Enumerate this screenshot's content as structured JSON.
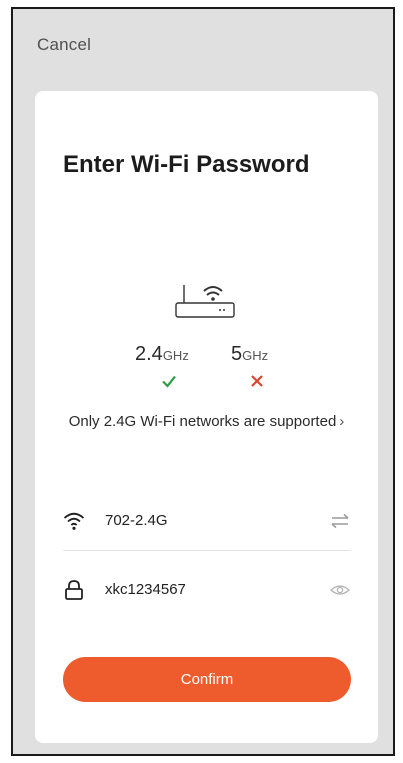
{
  "header": {
    "cancel_label": "Cancel"
  },
  "card": {
    "title": "Enter Wi-Fi Password",
    "bands": {
      "band_24": {
        "value": "2.4",
        "unit": "GHz",
        "status": "supported",
        "status_icon": "check-icon",
        "color": "#2e9e45"
      },
      "band_5": {
        "value": "5",
        "unit": "GHz",
        "status": "unsupported",
        "status_icon": "cross-icon",
        "color": "#e0432c"
      }
    },
    "support_note": "Only 2.4G Wi-Fi networks are supported",
    "support_note_chevron": "›",
    "network": {
      "ssid": "702-2.4G",
      "icon": "wifi-icon",
      "switch_icon": "swap-arrows-icon"
    },
    "password": {
      "value": "xkc1234567",
      "icon": "lock-icon",
      "visibility_icon": "eye-icon"
    },
    "confirm_label": "Confirm"
  },
  "colors": {
    "accent": "#ee5b2d",
    "background": "#e0e0e0",
    "card": "#ffffff"
  }
}
